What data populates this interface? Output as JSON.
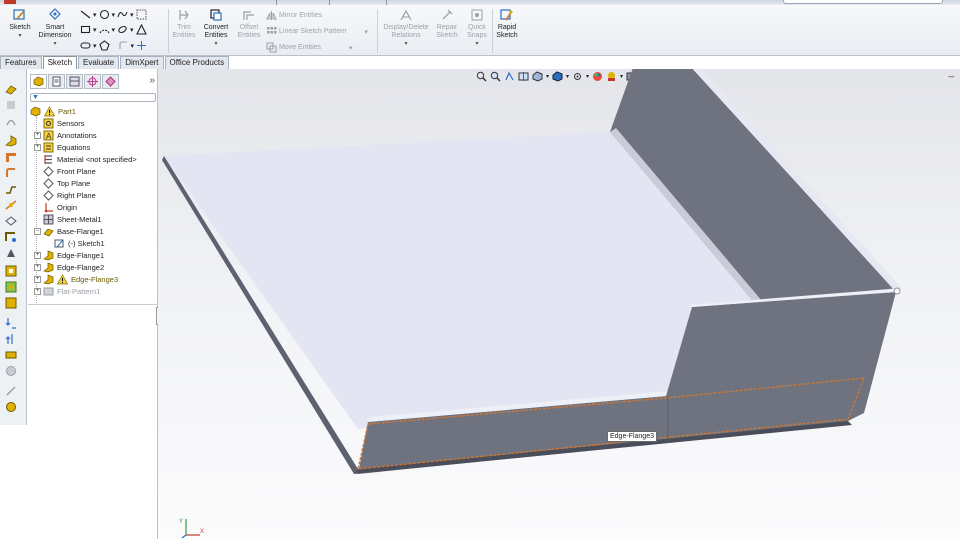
{
  "toolbar": {
    "sketch_label": "Sketch",
    "smart_dimension_label": "Smart\nDimension",
    "trim_label": "Trim\nEntities",
    "convert_label": "Convert\nEntities",
    "offset_label": "Offset\nEntities",
    "mirror_label": "Mirror Entities",
    "linear_pattern_label": "Linear Sketch Pattern",
    "move_label": "Move Entities",
    "display_delete_label": "Display/Delete\nRelations",
    "repair_label": "Repair\nSketch",
    "quick_snaps_label": "Quick\nSnaps",
    "rapid_sketch_label": "Rapid\nSketch"
  },
  "tabs": [
    "Features",
    "Sketch",
    "Evaluate",
    "DimXpert",
    "Office Products"
  ],
  "active_tab": "Sketch",
  "tree": {
    "root": "Part1",
    "items": [
      {
        "label": "Sensors"
      },
      {
        "label": "Annotations"
      },
      {
        "label": "Equations"
      },
      {
        "label": "Material <not specified>"
      },
      {
        "label": "Front Plane"
      },
      {
        "label": "Top Plane"
      },
      {
        "label": "Right Plane"
      },
      {
        "label": "Origin"
      },
      {
        "label": "Sheet-Metal1"
      },
      {
        "label": "Base-Flange1"
      },
      {
        "label": "(-) Sketch1"
      },
      {
        "label": "Edge-Flange1"
      },
      {
        "label": "Edge-Flange2"
      },
      {
        "label": "Edge-Flange3"
      },
      {
        "label": "Flat-Pattern1"
      }
    ]
  },
  "viewport": {
    "tooltip": "Edge-Flange3",
    "triad_axes": [
      "Y",
      "X"
    ]
  },
  "colors": {
    "accent_orange": "#d4772c",
    "plate_top": "#e3e5f3",
    "flange_face": "#6f7380",
    "warning": "#e0b100"
  },
  "icons": [
    "sketch-icon",
    "smart-dimension-icon",
    "line-icon",
    "rectangle-icon",
    "circle-icon",
    "arc-icon",
    "spline-icon",
    "trim-icon",
    "convert-icon",
    "offset-icon",
    "mirror-icon",
    "linear-pattern-icon",
    "move-icon",
    "display-relations-icon",
    "repair-icon",
    "quick-snaps-icon",
    "rapid-sketch-icon"
  ]
}
